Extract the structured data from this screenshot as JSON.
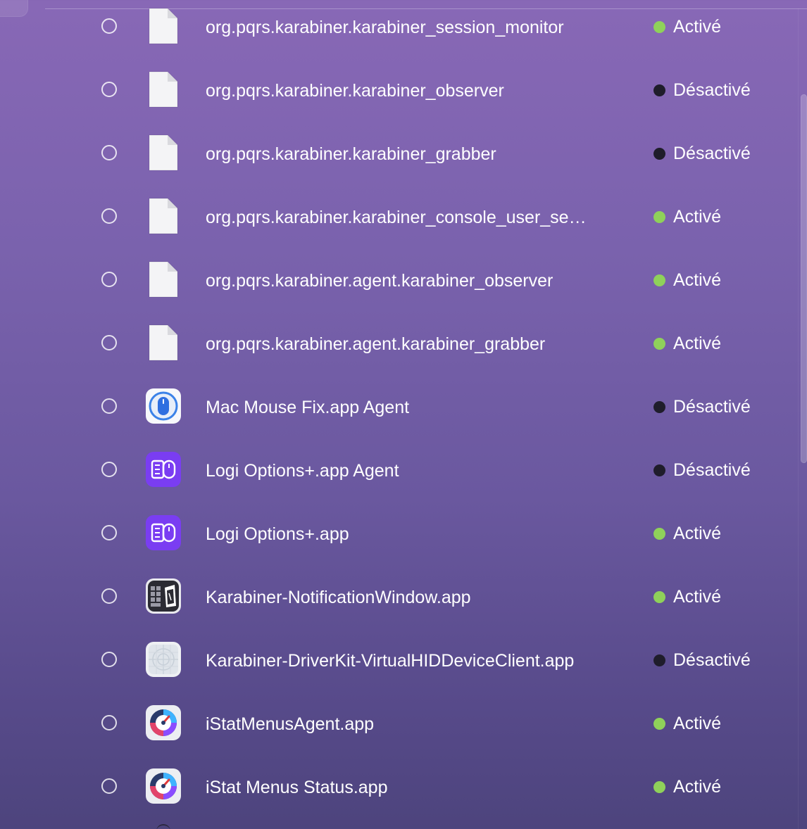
{
  "items": [
    {
      "label": "org.pqrs.karabiner.karabiner_session_monitor",
      "status": "Activé",
      "enabled": true,
      "icon": "document-icon"
    },
    {
      "label": "org.pqrs.karabiner.karabiner_observer",
      "status": "Désactivé",
      "enabled": false,
      "icon": "document-icon"
    },
    {
      "label": "org.pqrs.karabiner.karabiner_grabber",
      "status": "Désactivé",
      "enabled": false,
      "icon": "document-icon"
    },
    {
      "label": "org.pqrs.karabiner.karabiner_console_user_se…",
      "status": "Activé",
      "enabled": true,
      "icon": "document-icon"
    },
    {
      "label": "org.pqrs.karabiner.agent.karabiner_observer",
      "status": "Activé",
      "enabled": true,
      "icon": "document-icon"
    },
    {
      "label": "org.pqrs.karabiner.agent.karabiner_grabber",
      "status": "Activé",
      "enabled": true,
      "icon": "document-icon"
    },
    {
      "label": "Mac Mouse Fix.app Agent",
      "status": "Désactivé",
      "enabled": false,
      "icon": "mac-mouse-fix-icon"
    },
    {
      "label": "Logi Options+.app Agent",
      "status": "Désactivé",
      "enabled": false,
      "icon": "logi-options-icon"
    },
    {
      "label": "Logi Options+.app",
      "status": "Activé",
      "enabled": true,
      "icon": "logi-options-icon"
    },
    {
      "label": "Karabiner-NotificationWindow.app",
      "status": "Activé",
      "enabled": true,
      "icon": "karabiner-icon"
    },
    {
      "label": "Karabiner-DriverKit-VirtualHIDDeviceClient.app",
      "status": "Désactivé",
      "enabled": false,
      "icon": "driverkit-icon"
    },
    {
      "label": "iStatMenusAgent.app",
      "status": "Activé",
      "enabled": true,
      "icon": "istat-menus-icon"
    },
    {
      "label": "iStat Menus Status.app",
      "status": "Activé",
      "enabled": true,
      "icon": "istat-menus-icon"
    }
  ],
  "colors": {
    "enabled_dot": "#8fd15a",
    "disabled_dot": "#1f1d2b"
  }
}
